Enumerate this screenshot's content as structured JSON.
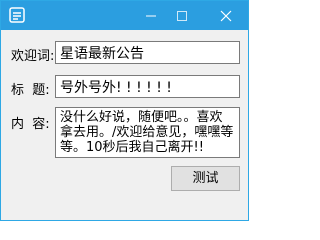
{
  "form": {
    "welcome_label": "欢迎词:",
    "welcome_value": "星语最新公告",
    "title_label": "标  题:",
    "title_value": "号外号外! ! ! ! ! !",
    "content_label": "内  容:",
    "content_value": "没什么好说，随便吧。。喜欢拿去用。/欢迎给意见，嘿嘿等等。10秒后我自己离开!!"
  },
  "buttons": {
    "test_label": "测试"
  },
  "colors": {
    "titlebar": "#2b9ee0",
    "window_bg": "#f0f0f0"
  }
}
